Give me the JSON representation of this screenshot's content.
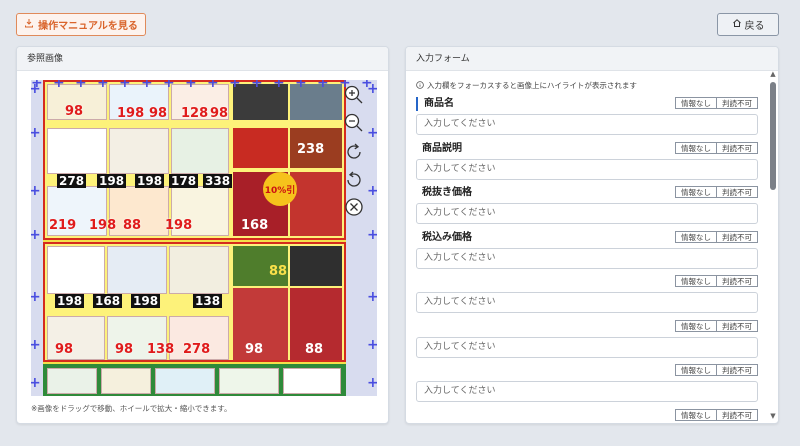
{
  "toolbar": {
    "manual_label": "操作マニュアルを見る",
    "manual_icon": "download-icon",
    "back_label": "戻る",
    "back_icon": "home-icon"
  },
  "left_panel": {
    "title": "参照画像",
    "hint": "※画像をドラッグで移動、ホイールで拡大・縮小できます。",
    "tools": [
      "zoom-in-icon",
      "zoom-out-icon",
      "rotate-right-icon",
      "rotate-left-icon",
      "close-icon"
    ],
    "flyer": {
      "prices": [
        "98",
        "198",
        "98",
        "128",
        "98",
        "278",
        "198",
        "198",
        "178",
        "338",
        "198",
        "238",
        "219",
        "198",
        "88",
        "168",
        "198",
        "168",
        "198",
        "138",
        "98",
        "138",
        "278",
        "88",
        "98",
        "98",
        "88"
      ],
      "discount_badge": "10%引"
    }
  },
  "right_panel": {
    "title": "入力フォーム",
    "info": "入力欄をフォーカスすると画像上にハイライトが表示されます",
    "chip_none": "情報なし",
    "chip_unreadable": "判読不可",
    "placeholder": "入力してください",
    "fields": [
      {
        "label": "商品名"
      },
      {
        "label": "商品説明"
      },
      {
        "label": "税抜き価格"
      },
      {
        "label": "税込み価格"
      },
      {
        "label": ""
      },
      {
        "label": ""
      },
      {
        "label": ""
      },
      {
        "label": ""
      }
    ]
  },
  "colors": {
    "accent_orange": "#d9642b",
    "active_field": "#2565c8",
    "crosshair": "#4a4ee0"
  }
}
